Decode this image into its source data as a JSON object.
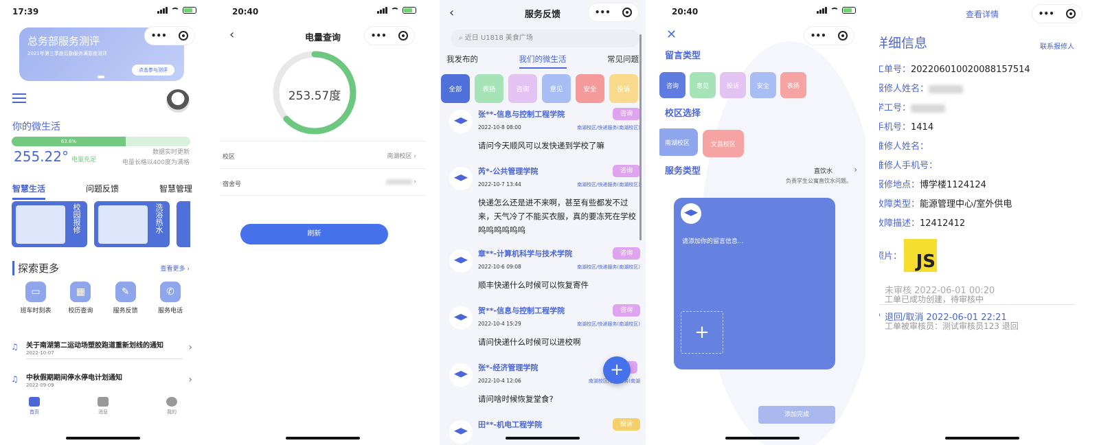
{
  "screen1": {
    "time": "17:39",
    "banner": {
      "title": "总务部服务测评",
      "subtitle": "2021年第三季度后勤服务满意度测评",
      "button": "点击参与测评"
    },
    "my_life": "你的微生活",
    "progress": {
      "percent_label": "63.8%",
      "fraction": 0.638
    },
    "kwh_value": "255.22°",
    "kwh_status": "电量充足",
    "realtime": "数据实时更新",
    "full_rule": "电量长格以400度为满格",
    "tabs": [
      "智慧生活",
      "问题反馈",
      "智慧管理"
    ],
    "cards": [
      {
        "label": "校园报修"
      },
      {
        "label": "洗浴热水"
      }
    ],
    "explore_title": "探索更多",
    "see_more": "查看更多 ›",
    "quick": [
      {
        "label": "班车时刻表",
        "icon": "bus-icon"
      },
      {
        "label": "校历查询",
        "icon": "calendar-icon"
      },
      {
        "label": "服务反馈",
        "icon": "feedback-icon"
      },
      {
        "label": "服务电话",
        "icon": "phone-icon"
      }
    ],
    "notices": [
      {
        "title": "关于南湖第二运动场塑胶跑道重新划线的通知",
        "date": "2022-10-07"
      },
      {
        "title": "中秋假期期间停水停电计划通知",
        "date": "2022-09-09"
      }
    ],
    "tabbar": [
      "首页",
      "消息",
      "我的"
    ]
  },
  "screen2": {
    "time": "20:40",
    "title": "电量查询",
    "reading": "253.57度",
    "ring_fraction": 0.63,
    "rows": [
      {
        "label": "校区",
        "value": "南湖校区"
      },
      {
        "label": "宿舍号",
        "value": ""
      }
    ],
    "refresh": "刷新"
  },
  "screen3": {
    "title": "服务反馈",
    "search_placeholder": "近日 U1818 美食广场",
    "tabs": [
      "我发布的",
      "我们的微生活",
      "常见问题"
    ],
    "chips": [
      {
        "label": "全部",
        "color": "#4f70d9"
      },
      {
        "label": "表扬",
        "color": "#a6e4b8"
      },
      {
        "label": "咨询",
        "color": "#e3c3f2"
      },
      {
        "label": "意见",
        "color": "#a9bdf5"
      },
      {
        "label": "安全",
        "color": "#f59a9a"
      },
      {
        "label": "投诉",
        "color": "#f9d98c"
      }
    ],
    "posts": [
      {
        "name": "张**-信息与控制工程学院",
        "tag": "咨询",
        "tag_color": "#dea4ef",
        "date": "2022-10-8 08:00",
        "loc": "南湖校区/快递服务(南湖校区)",
        "body": "请问今天顺风可以发快递到学校了嘛"
      },
      {
        "name": "芮*-公共管理学院",
        "tag": "咨询",
        "tag_color": "#dea4ef",
        "date": "2022-10-7 13:44",
        "loc": "南湖校区/快递服务(南湖校区)",
        "body": "快递怎么还是进不来啊，甚至有些都发不过来，天气冷了不能买衣服，真的要冻死在学校呜呜呜呜呜呜"
      },
      {
        "name": "章**-计算机科学与技术学院",
        "tag": "咨询",
        "tag_color": "#dea4ef",
        "date": "2022-10-6 09:08",
        "loc": "南湖校区/快递服务(南湖校区)",
        "body": "顺丰快递什么时候可以恢复寄件"
      },
      {
        "name": "贺**-信息与控制工程学院",
        "tag": "咨询",
        "tag_color": "#dea4ef",
        "date": "2022-10-4 15:29",
        "loc": "南湖校区/快递服务(南湖校区)",
        "body": "请问快递什么时候可以进校啊"
      },
      {
        "name": "张*-经济管理学院",
        "tag": "",
        "tag_color": "#dea4ef",
        "date": "2022-10-4 12:06",
        "loc": "南湖校区/餐饮服务(南湖",
        "body": "请问啥时候恢复堂食?"
      },
      {
        "name": "田**-机电工程学院",
        "tag": "投诉",
        "tag_color": "#f5cf6a",
        "date": "",
        "loc": "",
        "body": ""
      }
    ],
    "fab": "+"
  },
  "screen4": {
    "time": "20:40",
    "msg_type_title": "留言类型",
    "types": [
      {
        "label": "咨询",
        "color": "#5f7ce0"
      },
      {
        "label": "意见",
        "color": "#a6e4b8"
      },
      {
        "label": "投诉",
        "color": "#e3c3f2"
      },
      {
        "label": "安全",
        "color": "#a9bdf5"
      },
      {
        "label": "表扬",
        "color": "#f5a3a3"
      }
    ],
    "campus_title": "校区选择",
    "campuses": [
      {
        "label": "南湖校区",
        "color": "#8fa6ec"
      },
      {
        "label": "文昌校区",
        "color": "#f5a3a3"
      }
    ],
    "service_title": "服务类型",
    "service_value": "直饮水",
    "service_desc": "负责学生公寓直饮水问题。",
    "placeholder": "请添加你的留言信息...",
    "done": "添加完成"
  },
  "screen5": {
    "title": "查看详情",
    "detail_title": "详细信息",
    "contact": "联系报修人",
    "fields": [
      {
        "k": "工单号：",
        "v": "202206010020088157514"
      },
      {
        "k": "报修人姓名：",
        "v": ""
      },
      {
        "k": "学工号：",
        "v": ""
      },
      {
        "k": "手机号：",
        "v": "1414"
      },
      {
        "k": "维修人姓名：",
        "v": ""
      },
      {
        "k": "维修人手机号：",
        "v": ""
      },
      {
        "k": "报修地点：",
        "v": "博学楼1124124"
      },
      {
        "k": "故障类型：",
        "v": "能源管理中心/室外供电"
      },
      {
        "k": "故障描述：",
        "v": "12412412"
      }
    ],
    "photo_label": "照片：",
    "photo_text": "JS",
    "timeline": [
      {
        "head": "未审核 2022-06-01 00:20",
        "sub": "工单已成功创建，待审核中",
        "head_color": "#aaa"
      },
      {
        "head": "退回/取消 2022-06-01 22:21",
        "sub": "工单被审核员：测试审核员123 退回",
        "head_color": "#4a66d8"
      }
    ]
  }
}
